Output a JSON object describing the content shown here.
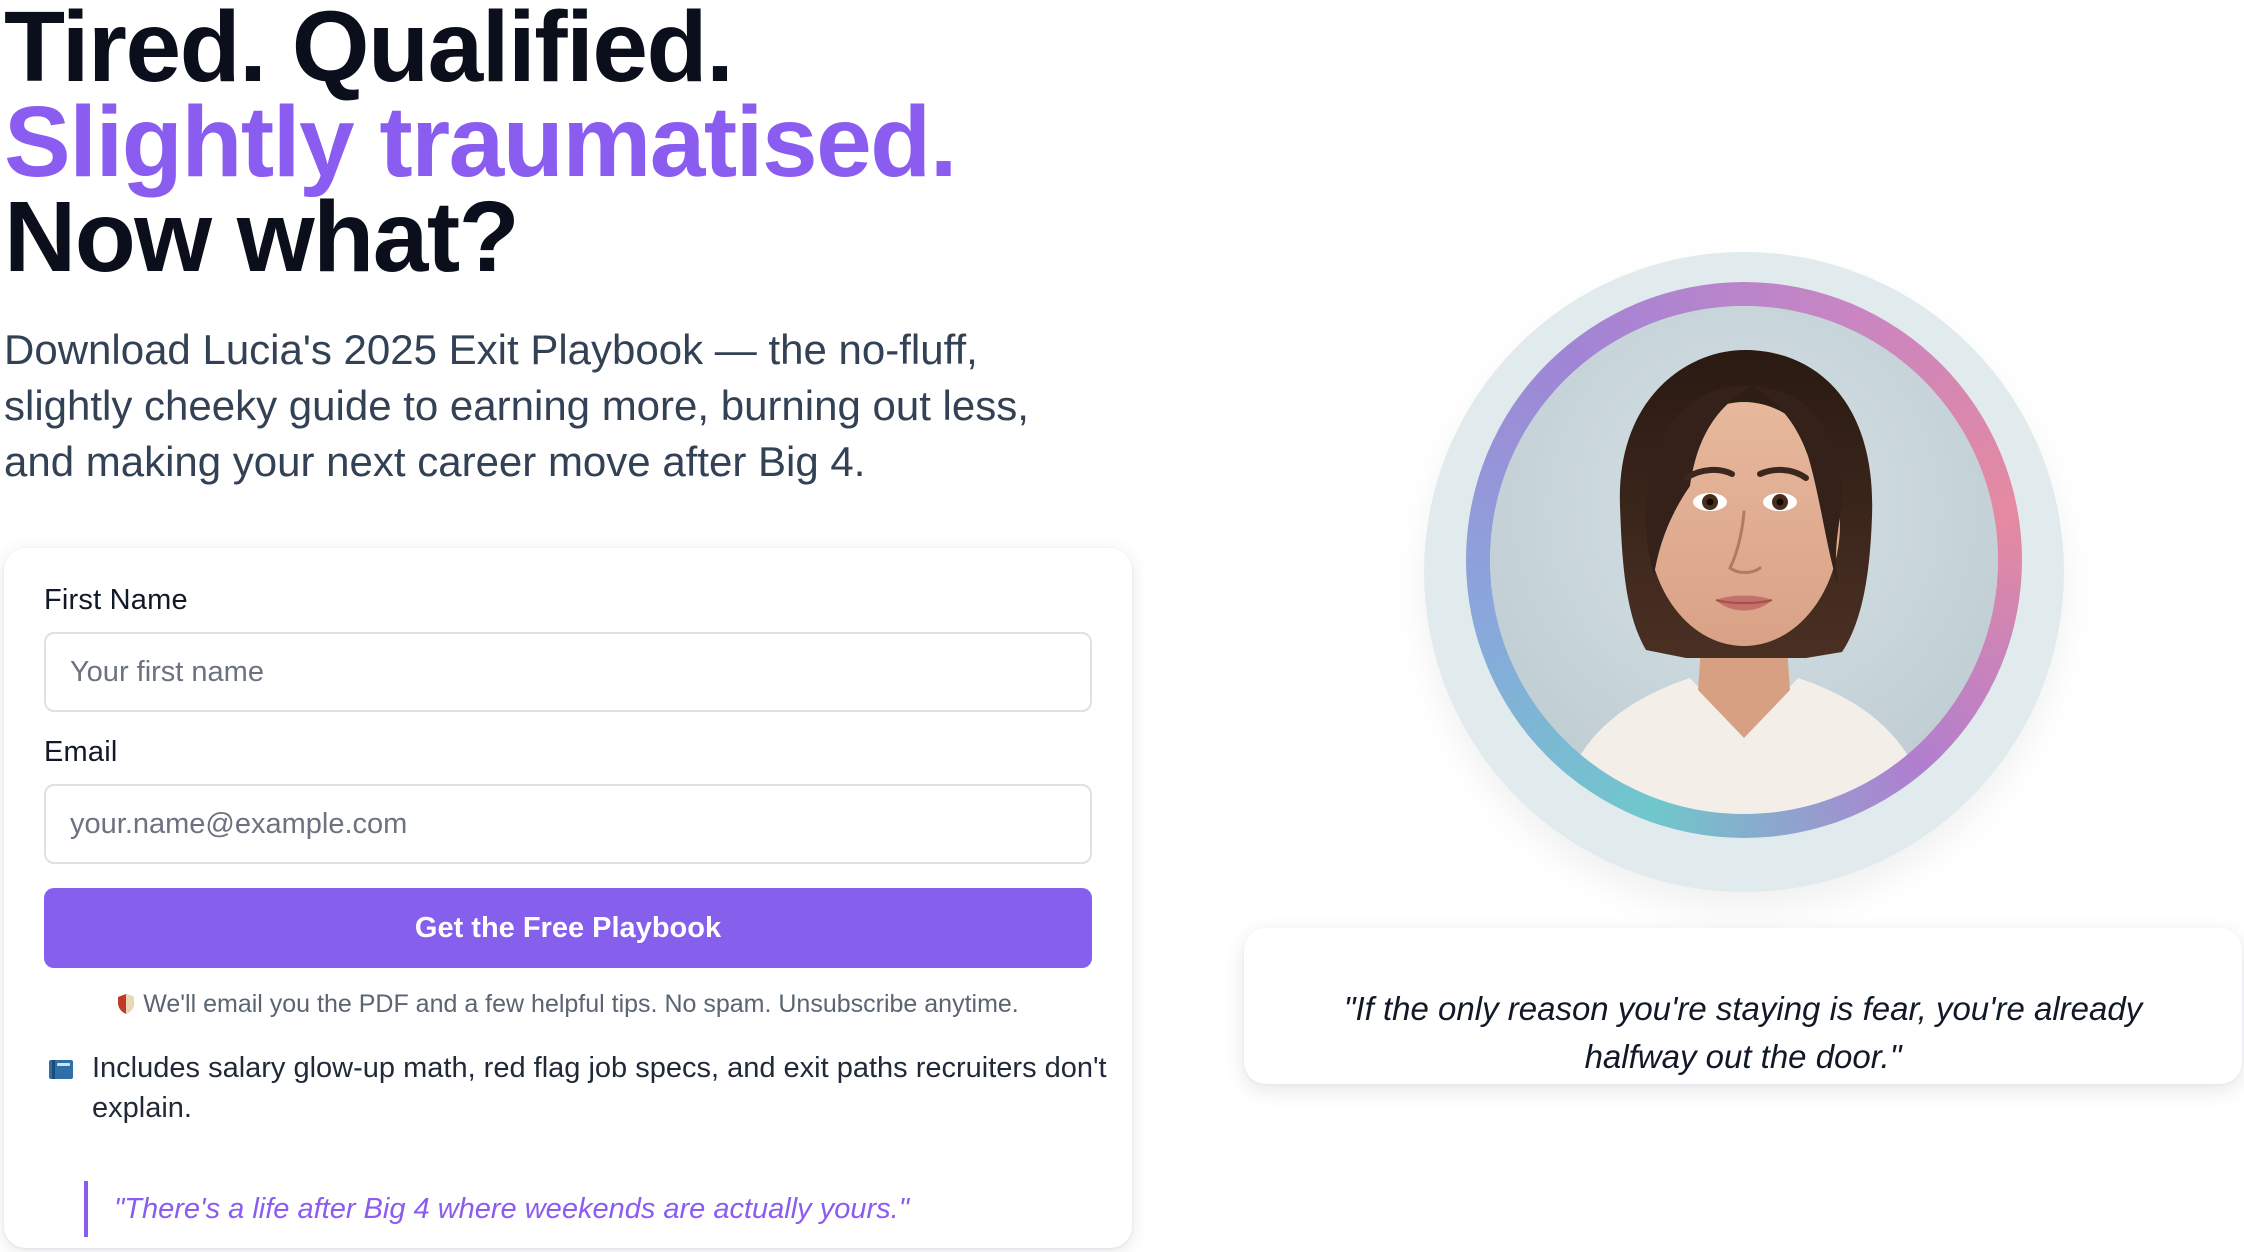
{
  "hero": {
    "headline_line1": "Tired. Qualified.",
    "headline_line2": "Slightly traumatised.",
    "headline_line3": "Now what?",
    "subheadline": "Download Lucia's 2025 Exit Playbook — the no-fluff, slightly cheeky guide to earning more, burning out less, and making your next career move after Big 4."
  },
  "form": {
    "first_name_label": "First Name",
    "first_name_placeholder": "Your first name",
    "first_name_value": "",
    "email_label": "Email",
    "email_placeholder": "your.name@example.com",
    "email_value": "",
    "submit_label": "Get the Free Playbook",
    "privacy_note": "We'll email you the PDF and a few helpful tips. No spam. Unsubscribe anytime.",
    "includes_text": "Includes salary glow-up math, red flag job specs, and exit paths recruiters don't explain.",
    "quote": "\"There's a life after Big 4 where weekends are actually yours.\""
  },
  "portrait": {
    "icon": "portrait-photo-icon",
    "ring_colors": [
      "#6fc8cc",
      "#a184d6",
      "#e58aa0"
    ]
  },
  "testimonial": {
    "quote": "\"If the only reason you're staying is fear, you're already halfway out the door.\""
  },
  "icons": {
    "privacy": "shield-icon",
    "includes": "book-icon"
  },
  "colors": {
    "accent": "#8b5cf0",
    "button": "#8660ec",
    "heading": "#0b0f1c",
    "body": "#334155"
  }
}
